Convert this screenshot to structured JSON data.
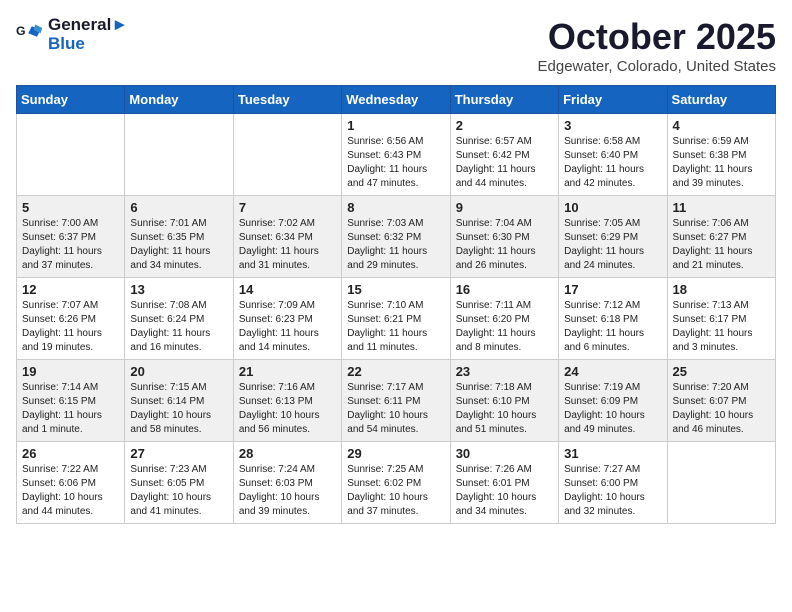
{
  "header": {
    "logo_line1": "General",
    "logo_line2": "Blue",
    "month": "October 2025",
    "location": "Edgewater, Colorado, United States"
  },
  "days_of_week": [
    "Sunday",
    "Monday",
    "Tuesday",
    "Wednesday",
    "Thursday",
    "Friday",
    "Saturday"
  ],
  "weeks": [
    [
      {
        "day": "",
        "sunrise": "",
        "sunset": "",
        "daylight": ""
      },
      {
        "day": "",
        "sunrise": "",
        "sunset": "",
        "daylight": ""
      },
      {
        "day": "",
        "sunrise": "",
        "sunset": "",
        "daylight": ""
      },
      {
        "day": "1",
        "sunrise": "Sunrise: 6:56 AM",
        "sunset": "Sunset: 6:43 PM",
        "daylight": "Daylight: 11 hours and 47 minutes."
      },
      {
        "day": "2",
        "sunrise": "Sunrise: 6:57 AM",
        "sunset": "Sunset: 6:42 PM",
        "daylight": "Daylight: 11 hours and 44 minutes."
      },
      {
        "day": "3",
        "sunrise": "Sunrise: 6:58 AM",
        "sunset": "Sunset: 6:40 PM",
        "daylight": "Daylight: 11 hours and 42 minutes."
      },
      {
        "day": "4",
        "sunrise": "Sunrise: 6:59 AM",
        "sunset": "Sunset: 6:38 PM",
        "daylight": "Daylight: 11 hours and 39 minutes."
      }
    ],
    [
      {
        "day": "5",
        "sunrise": "Sunrise: 7:00 AM",
        "sunset": "Sunset: 6:37 PM",
        "daylight": "Daylight: 11 hours and 37 minutes."
      },
      {
        "day": "6",
        "sunrise": "Sunrise: 7:01 AM",
        "sunset": "Sunset: 6:35 PM",
        "daylight": "Daylight: 11 hours and 34 minutes."
      },
      {
        "day": "7",
        "sunrise": "Sunrise: 7:02 AM",
        "sunset": "Sunset: 6:34 PM",
        "daylight": "Daylight: 11 hours and 31 minutes."
      },
      {
        "day": "8",
        "sunrise": "Sunrise: 7:03 AM",
        "sunset": "Sunset: 6:32 PM",
        "daylight": "Daylight: 11 hours and 29 minutes."
      },
      {
        "day": "9",
        "sunrise": "Sunrise: 7:04 AM",
        "sunset": "Sunset: 6:30 PM",
        "daylight": "Daylight: 11 hours and 26 minutes."
      },
      {
        "day": "10",
        "sunrise": "Sunrise: 7:05 AM",
        "sunset": "Sunset: 6:29 PM",
        "daylight": "Daylight: 11 hours and 24 minutes."
      },
      {
        "day": "11",
        "sunrise": "Sunrise: 7:06 AM",
        "sunset": "Sunset: 6:27 PM",
        "daylight": "Daylight: 11 hours and 21 minutes."
      }
    ],
    [
      {
        "day": "12",
        "sunrise": "Sunrise: 7:07 AM",
        "sunset": "Sunset: 6:26 PM",
        "daylight": "Daylight: 11 hours and 19 minutes."
      },
      {
        "day": "13",
        "sunrise": "Sunrise: 7:08 AM",
        "sunset": "Sunset: 6:24 PM",
        "daylight": "Daylight: 11 hours and 16 minutes."
      },
      {
        "day": "14",
        "sunrise": "Sunrise: 7:09 AM",
        "sunset": "Sunset: 6:23 PM",
        "daylight": "Daylight: 11 hours and 14 minutes."
      },
      {
        "day": "15",
        "sunrise": "Sunrise: 7:10 AM",
        "sunset": "Sunset: 6:21 PM",
        "daylight": "Daylight: 11 hours and 11 minutes."
      },
      {
        "day": "16",
        "sunrise": "Sunrise: 7:11 AM",
        "sunset": "Sunset: 6:20 PM",
        "daylight": "Daylight: 11 hours and 8 minutes."
      },
      {
        "day": "17",
        "sunrise": "Sunrise: 7:12 AM",
        "sunset": "Sunset: 6:18 PM",
        "daylight": "Daylight: 11 hours and 6 minutes."
      },
      {
        "day": "18",
        "sunrise": "Sunrise: 7:13 AM",
        "sunset": "Sunset: 6:17 PM",
        "daylight": "Daylight: 11 hours and 3 minutes."
      }
    ],
    [
      {
        "day": "19",
        "sunrise": "Sunrise: 7:14 AM",
        "sunset": "Sunset: 6:15 PM",
        "daylight": "Daylight: 11 hours and 1 minute."
      },
      {
        "day": "20",
        "sunrise": "Sunrise: 7:15 AM",
        "sunset": "Sunset: 6:14 PM",
        "daylight": "Daylight: 10 hours and 58 minutes."
      },
      {
        "day": "21",
        "sunrise": "Sunrise: 7:16 AM",
        "sunset": "Sunset: 6:13 PM",
        "daylight": "Daylight: 10 hours and 56 minutes."
      },
      {
        "day": "22",
        "sunrise": "Sunrise: 7:17 AM",
        "sunset": "Sunset: 6:11 PM",
        "daylight": "Daylight: 10 hours and 54 minutes."
      },
      {
        "day": "23",
        "sunrise": "Sunrise: 7:18 AM",
        "sunset": "Sunset: 6:10 PM",
        "daylight": "Daylight: 10 hours and 51 minutes."
      },
      {
        "day": "24",
        "sunrise": "Sunrise: 7:19 AM",
        "sunset": "Sunset: 6:09 PM",
        "daylight": "Daylight: 10 hours and 49 minutes."
      },
      {
        "day": "25",
        "sunrise": "Sunrise: 7:20 AM",
        "sunset": "Sunset: 6:07 PM",
        "daylight": "Daylight: 10 hours and 46 minutes."
      }
    ],
    [
      {
        "day": "26",
        "sunrise": "Sunrise: 7:22 AM",
        "sunset": "Sunset: 6:06 PM",
        "daylight": "Daylight: 10 hours and 44 minutes."
      },
      {
        "day": "27",
        "sunrise": "Sunrise: 7:23 AM",
        "sunset": "Sunset: 6:05 PM",
        "daylight": "Daylight: 10 hours and 41 minutes."
      },
      {
        "day": "28",
        "sunrise": "Sunrise: 7:24 AM",
        "sunset": "Sunset: 6:03 PM",
        "daylight": "Daylight: 10 hours and 39 minutes."
      },
      {
        "day": "29",
        "sunrise": "Sunrise: 7:25 AM",
        "sunset": "Sunset: 6:02 PM",
        "daylight": "Daylight: 10 hours and 37 minutes."
      },
      {
        "day": "30",
        "sunrise": "Sunrise: 7:26 AM",
        "sunset": "Sunset: 6:01 PM",
        "daylight": "Daylight: 10 hours and 34 minutes."
      },
      {
        "day": "31",
        "sunrise": "Sunrise: 7:27 AM",
        "sunset": "Sunset: 6:00 PM",
        "daylight": "Daylight: 10 hours and 32 minutes."
      },
      {
        "day": "",
        "sunrise": "",
        "sunset": "",
        "daylight": ""
      }
    ]
  ]
}
